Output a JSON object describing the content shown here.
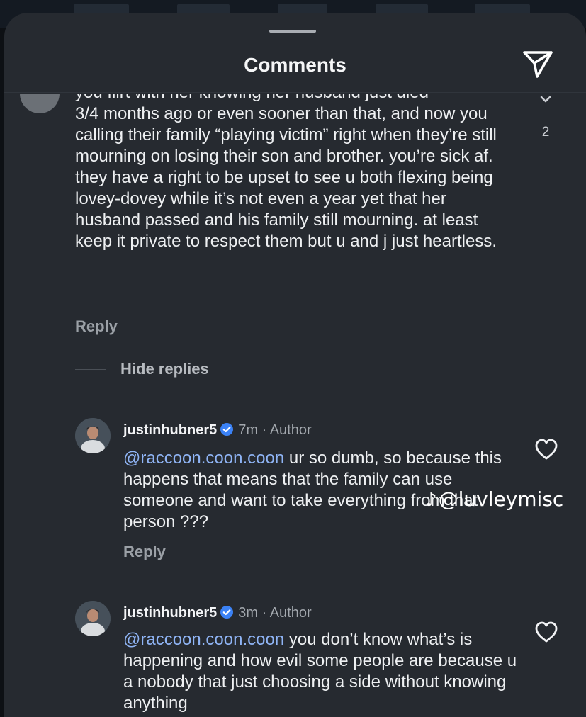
{
  "header": {
    "title": "Comments"
  },
  "main_comment": {
    "partial_line": "you flirt with her knowing her husband just died",
    "text": "3/4 months ago or even sooner than that, and now you calling their family “playing victim” right when they’re still mourning on losing their son and brother. you’re sick af. they have a right to be upset to see u both flexing being lovey-dovey while it’s not even a year yet that her husband passed and his family still mourning. at least keep it private to respect them but u and j just heartless.",
    "like_count": "2",
    "reply_label": "Reply"
  },
  "hide_replies_label": "Hide replies",
  "replies": [
    {
      "username": "justinhubner5",
      "time": "7m",
      "separator": "·",
      "author_label": "Author",
      "mention": "@raccoon.coon.coon",
      "text": " ur so dumb, so because this happens that means that the family can use someone and want to take everything from that person ???",
      "reply_label": "Reply"
    },
    {
      "username": "justinhubner5",
      "time": "3m",
      "separator": "·",
      "author_label": "Author",
      "mention": "@raccoon.coon.coon",
      "text": " you don’t know what’s is happening and how evil some people are because u a nobody that just choosing a side without knowing anything"
    }
  ],
  "watermark": {
    "text": "@luvleymisc"
  },
  "icons": {
    "send": "send-icon",
    "heart": "heart-icon",
    "verified": "verified-badge-icon",
    "chevron": "chevron-down-icon",
    "tiktok": "tiktok-logo-icon"
  },
  "colors": {
    "sheet_bg": "#262a30",
    "mention": "#8fb4f5",
    "verified": "#3b82f6",
    "muted": "#9ba0a6"
  }
}
